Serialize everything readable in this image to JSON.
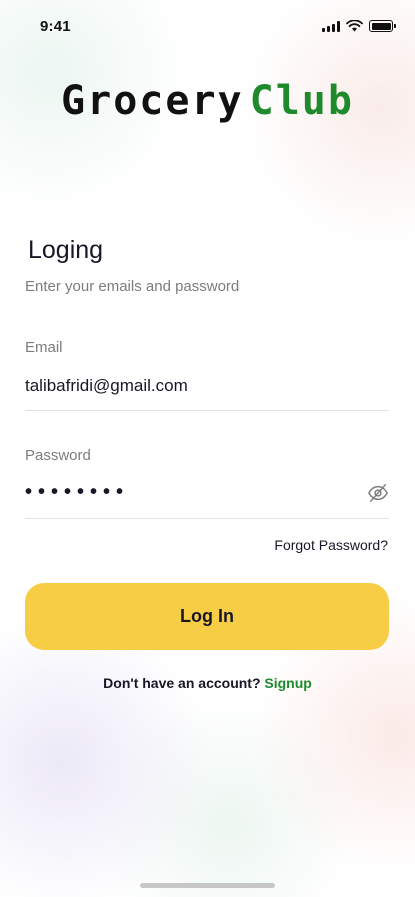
{
  "status_bar": {
    "time": "9:41",
    "icons": [
      "cellular-signal-icon",
      "wifi-icon",
      "battery-icon"
    ]
  },
  "logo": {
    "word1": "Grocery",
    "word2": "Club",
    "word2_color": "#1e8a2b",
    "o_icon": "tomato-icon"
  },
  "login": {
    "title": "Loging",
    "subtitle": "Enter your emails and password"
  },
  "email": {
    "label": "Email",
    "value": "talibafridi@gmail.com"
  },
  "password": {
    "label": "Password",
    "value": "••••••••",
    "toggle_icon": "eye-off-icon"
  },
  "forgot_password": "Forgot Password?",
  "login_button": {
    "label": "Log In",
    "color": "#F8CD46"
  },
  "signup": {
    "prompt": "Don't have an account?",
    "link": "Signup"
  }
}
